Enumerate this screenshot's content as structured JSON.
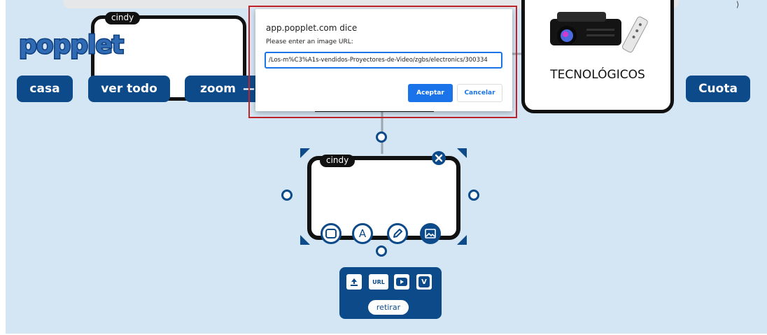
{
  "app": {
    "logo": "popplet",
    "nav": {
      "home": "casa",
      "view_all": "ver todo",
      "zoom": "zoom",
      "share": "Cuota"
    }
  },
  "popples": {
    "top_left_author": "cindy",
    "top_right_text": "TECNOLÓGICOS",
    "selected_author": "cindy"
  },
  "media_panel": {
    "upload_icon": "upload-icon",
    "url_label": "URL",
    "youtube_icon": "youtube-icon",
    "vimeo_label": "V",
    "remove_label": "retirar"
  },
  "dialog": {
    "title": "app.popplet.com dice",
    "message": "Please enter an image URL:",
    "input_value": "/Los-m%C3%A1s-vendidos-Proyectores-de-Video/zgbs/electronics/300334",
    "accept": "Aceptar",
    "cancel": "Cancelar"
  },
  "colors": {
    "canvas": "#d4e5f3",
    "brand_blue": "#0c4a8a",
    "dialog_accent": "#1a73e8",
    "highlight_outline": "#c0232a"
  }
}
